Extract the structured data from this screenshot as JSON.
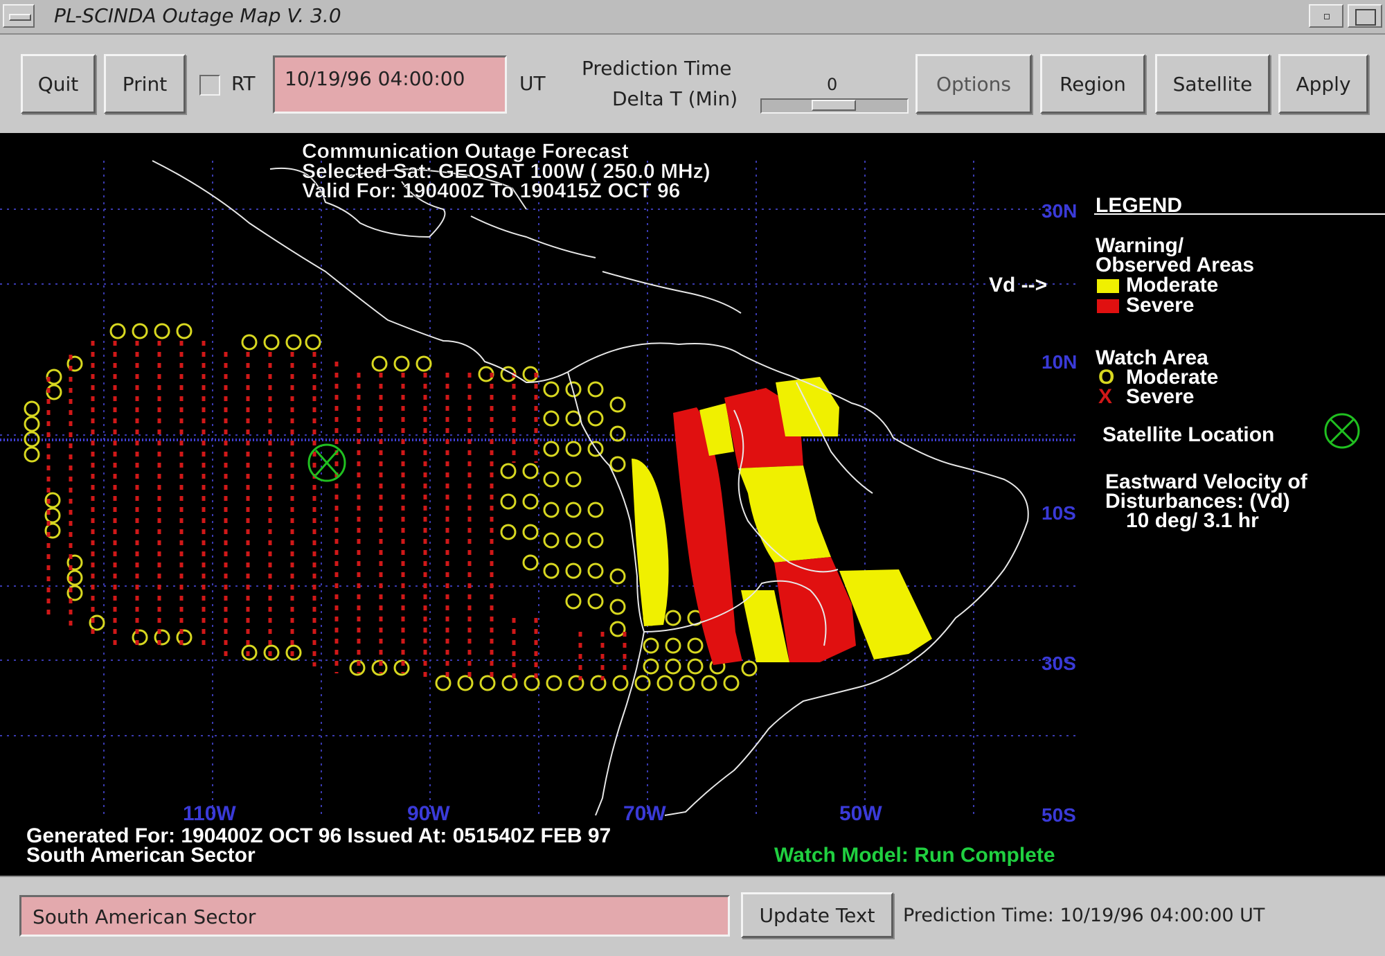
{
  "window": {
    "title": "PL-SCINDA Outage Map V. 3.0"
  },
  "toolbar": {
    "quit_label": "Quit",
    "print_label": "Print",
    "rt_label": "RT",
    "datetime_value": "10/19/96 04:00:00",
    "ut_label": "UT",
    "prediction_time_label": "Prediction Time",
    "delta_t_label": "Delta T (Min)",
    "delta_t_value": "0",
    "options_label": "Options",
    "region_label": "Region",
    "satellite_label": "Satellite",
    "apply_label": "Apply"
  },
  "map": {
    "header_line1": "Communication Outage Forecast",
    "header_line2": "Selected Sat:  GEOSAT 100W (  250.0 MHz)",
    "header_line3": "Valid For: 190400Z To 190415Z OCT 96",
    "lat_labels": [
      "30N",
      "10N",
      "10S",
      "30S",
      "50S"
    ],
    "lon_labels": [
      "110W",
      "90W",
      "70W",
      "50W"
    ],
    "vd_label": "Vd -->",
    "footer_line1": "Generated For: 190400Z OCT 96  Issued At: 051540Z FEB 97",
    "footer_line2": "South American Sector",
    "model_status": "Watch Model: Run Complete",
    "colors": {
      "moderate": "#f0f000",
      "severe": "#e01010",
      "satellite": "#20c020",
      "grid": "#4444cc",
      "status": "#20d040"
    }
  },
  "legend": {
    "title": "LEGEND",
    "warning_title_line1": "Warning/",
    "warning_title_line2": "Observed Areas",
    "moderate_label": "Moderate",
    "severe_label": "Severe",
    "watch_title": "Watch Area",
    "watch_moderate_marker": "O",
    "watch_severe_marker": "X",
    "satellite_label": "Satellite Location",
    "velocity_line1": "Eastward Velocity of",
    "velocity_line2": "Disturbances: (Vd)",
    "velocity_line3": "10 deg/ 3.1 hr"
  },
  "statusbar": {
    "sector_value": "South American Sector",
    "update_label": "Update Text",
    "prediction_time_text": "Prediction Time:  10/19/96 04:00:00  UT"
  }
}
